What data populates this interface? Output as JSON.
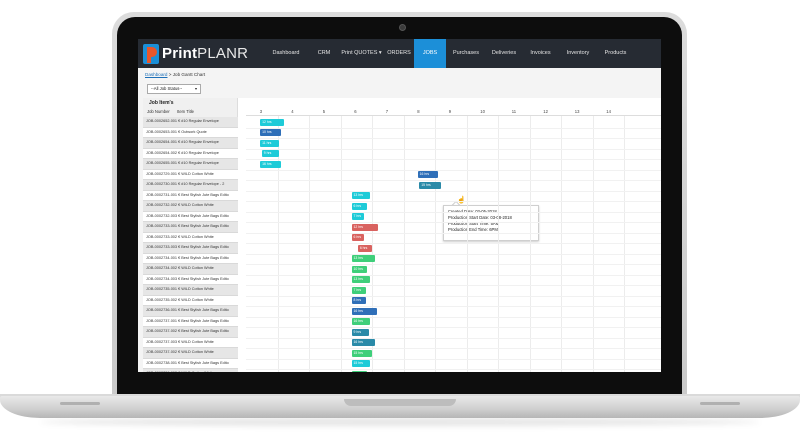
{
  "app": {
    "logo_print": "Print",
    "logo_planr": "PLANR"
  },
  "nav": {
    "items": [
      {
        "label": "Dashboard",
        "w": 46,
        "active": false
      },
      {
        "label": "CRM",
        "w": 30,
        "active": false
      },
      {
        "label": "Print QUOTES ▾",
        "w": 45,
        "active": false
      },
      {
        "label": "ORDERS",
        "w": 30,
        "active": false
      },
      {
        "label": "JOBS",
        "w": 32,
        "active": true
      },
      {
        "label": "Purchases",
        "w": 40,
        "active": false
      },
      {
        "label": "Deliveries",
        "w": 36,
        "active": false
      },
      {
        "label": "Invoices",
        "w": 37,
        "active": false
      },
      {
        "label": "Inventory",
        "w": 38,
        "active": false
      },
      {
        "label": "Products",
        "w": 37,
        "active": false
      }
    ]
  },
  "breadcrumb": {
    "link": "Dashboard",
    "current": " > Job Gantt Chart"
  },
  "filter": {
    "selected": "--All Job Status--"
  },
  "left": {
    "title": "Job Item's",
    "col_job": "Job Number",
    "col_item": "Item Title",
    "rows": [
      "JOB-0002652-001 € #10 Regular Envelope",
      "JOB-0002653-001 € Outwork Quote",
      "JOB-0002654-001 € #10 Regular Envelope",
      "JOB-0002654-002 € #10 Regular Envelope",
      "JOB-0002655-001 € #10 Regular Envelope",
      "JOB-0002729-001 € WILD Cotton White",
      "JOB-0002730-001 € #10 Regular Envelope - 2",
      "JOB-0002731-001 € Best Stylish Jute Bags Edito",
      "JOB-0002732-002 € WILD Cotton White",
      "JOB-0002732-003 € Best Stylish Jute Bags Edito",
      "JOB-0002733-001 € Best Stylish Jute Bags Edito",
      "JOB-0002733-002 € WILD Cotton White",
      "JOB-0002733-003 € Best Stylish Jute Bags Edito",
      "JOB-0002734-001 € Best Stylish Jute Bags Edito",
      "JOB-0002734-002 € WILD Cotton White",
      "JOB-0002734-003 € Best Stylish Jute Bags Edito",
      "JOB-0002735-001 € WILD Cotton White",
      "JOB-0002735-002 € WILD Cotton White",
      "JOB-0002736-001 € Best Stylish Jute Bags Edito",
      "JOB-0002737-001 € Best Stylish Jute Bags Edito",
      "JOB-0002737-002 € Best Stylish Jute Bags Edito",
      "JOB-0002737-003 € WILD Cotton White",
      "JOB-0002737-002 € WILD Cotton White",
      "JOB-0002738-001 € Best Stylish Jute Bags Edito",
      "JOB-0002738-002 € WILD Cotton White"
    ]
  },
  "chart_data": {
    "type": "gantt",
    "days": [
      "3",
      "4",
      "5",
      "6",
      "7",
      "8",
      "9",
      "10",
      "11",
      "12",
      "13",
      "14"
    ],
    "bars": [
      {
        "row": 0,
        "start": 2.95,
        "end": 3.7,
        "label": "12 hrs",
        "color": "#1ecbd8"
      },
      {
        "row": 1,
        "start": 2.95,
        "end": 3.6,
        "label": "10 hrs",
        "color": "#2f6fb8"
      },
      {
        "row": 2,
        "start": 2.95,
        "end": 3.55,
        "label": "11 hrs",
        "color": "#1ecbd8"
      },
      {
        "row": 3,
        "start": 3.0,
        "end": 3.55,
        "label": "9 hrs",
        "color": "#1ecbd8"
      },
      {
        "row": 4,
        "start": 2.95,
        "end": 3.6,
        "label": "16 hrs",
        "color": "#1ecbd8"
      },
      {
        "row": 5,
        "start": 7.95,
        "end": 8.6,
        "label": "16 hrs",
        "color": "#2f6fb8"
      },
      {
        "row": 6,
        "start": 8.0,
        "end": 8.7,
        "label": "15 hrs",
        "color": "#2a8aa8"
      },
      {
        "row": 7,
        "start": 5.85,
        "end": 6.45,
        "label": "13 hrs",
        "color": "#1ecbd8"
      },
      {
        "row": 8,
        "start": 5.85,
        "end": 6.35,
        "label": "6 hrs",
        "color": "#1ecbd8"
      },
      {
        "row": 9,
        "start": 5.85,
        "end": 6.25,
        "label": "7 hrs",
        "color": "#1ecbd8"
      },
      {
        "row": 10,
        "start": 5.85,
        "end": 6.7,
        "label": "12 hrs",
        "color": "#d9625f"
      },
      {
        "row": 11,
        "start": 5.85,
        "end": 6.25,
        "label": "6 hrs",
        "color": "#d9625f"
      },
      {
        "row": 12,
        "start": 6.05,
        "end": 6.5,
        "label": "6 hrs",
        "color": "#d9625f"
      },
      {
        "row": 13,
        "start": 5.85,
        "end": 6.6,
        "label": "13 hrs",
        "color": "#3fcf7a"
      },
      {
        "row": 14,
        "start": 5.85,
        "end": 6.35,
        "label": "10 hrs",
        "color": "#3fcf7a"
      },
      {
        "row": 15,
        "start": 5.85,
        "end": 6.45,
        "label": "13 hrs",
        "color": "#3fcf7a"
      },
      {
        "row": 16,
        "start": 5.85,
        "end": 6.3,
        "label": "7 hrs",
        "color": "#3fcf7a"
      },
      {
        "row": 17,
        "start": 5.85,
        "end": 6.3,
        "label": "8 hrs",
        "color": "#2f6fb8"
      },
      {
        "row": 18,
        "start": 5.85,
        "end": 6.65,
        "label": "16 hrs",
        "color": "#2f6fb8"
      },
      {
        "row": 19,
        "start": 5.85,
        "end": 6.45,
        "label": "16 hrs",
        "color": "#3fcf7a"
      },
      {
        "row": 20,
        "start": 5.85,
        "end": 6.4,
        "label": "9 hrs",
        "color": "#2a8aa8"
      },
      {
        "row": 21,
        "start": 5.85,
        "end": 6.6,
        "label": "16 hrs",
        "color": "#2a8aa8"
      },
      {
        "row": 22,
        "start": 5.85,
        "end": 6.5,
        "label": "15 hrs",
        "color": "#3fcf7a"
      },
      {
        "row": 23,
        "start": 5.85,
        "end": 6.45,
        "label": "15 hrs",
        "color": "#1ecbd8"
      },
      {
        "row": 24,
        "start": 5.85,
        "end": 6.35,
        "label": "16 hrs",
        "color": "#3fcf7a"
      }
    ]
  },
  "tooltip": {
    "created": "Created Date: 03-05-2018",
    "start": "Production Start Date: 03-08-2018",
    "start_time": "Production Start Time: 5AM",
    "end_time": "Production End Time: 6PM"
  }
}
